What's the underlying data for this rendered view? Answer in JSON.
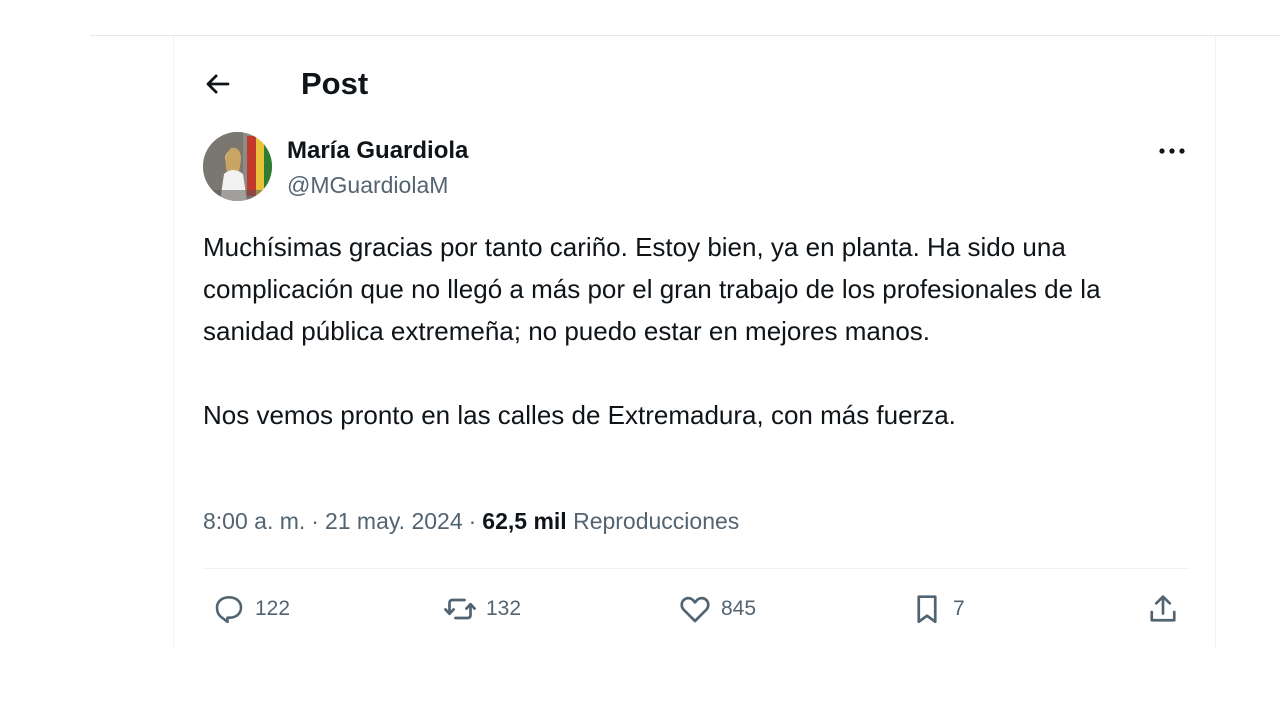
{
  "header": {
    "back_icon": "arrow-left-icon",
    "title": "Post"
  },
  "author": {
    "display_name": "María Guardiola",
    "handle": "@MGuardiolaM",
    "more_icon": "more-horizontal-icon"
  },
  "tweet": {
    "paragraph_1": "Muchísimas gracias por tanto cariño. Estoy bien, ya en planta. Ha sido una complicación que no llegó a más por el gran trabajo de los profesionales de la sanidad pública extremeña; no puedo estar en mejores manos.",
    "paragraph_2": "Nos vemos pronto en las calles de Extremadura, con más fuerza.",
    "time": "8:00 a. m.",
    "date": "21 may. 2024",
    "views_count": "62,5 mil",
    "views_label": "Reproducciones"
  },
  "actions": {
    "replies": "122",
    "reposts": "132",
    "likes": "845",
    "bookmarks": "7"
  },
  "colors": {
    "text_primary": "#0f1419",
    "text_secondary": "#536471",
    "divider": "#eff3f4"
  }
}
